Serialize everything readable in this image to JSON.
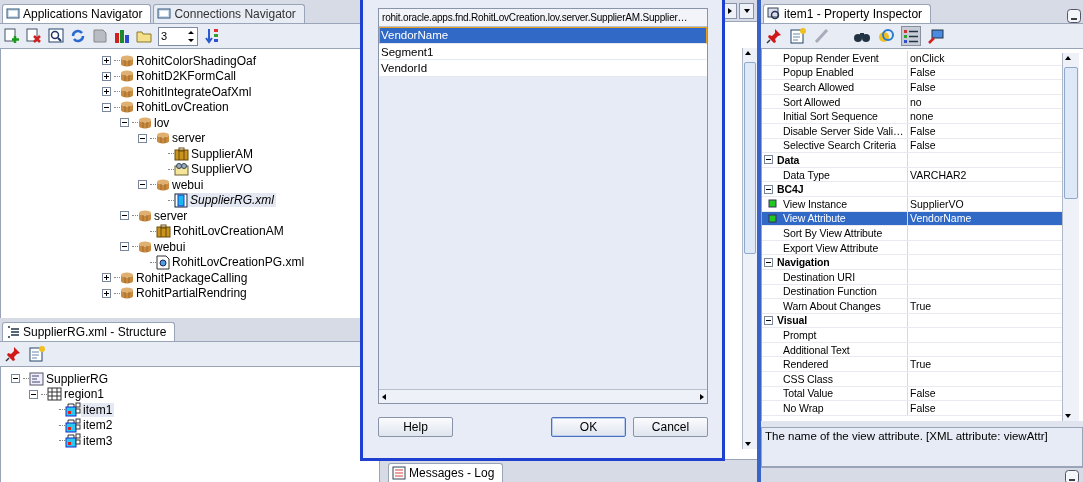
{
  "navigator": {
    "tabs": [
      {
        "label": "Applications Navigator",
        "selected": true
      },
      {
        "label": "Connections Navigator",
        "selected": false
      }
    ],
    "levels": "3",
    "tree": [
      {
        "label": "RohitColorShadingOaf",
        "kind": "package",
        "expanded": false
      },
      {
        "label": "RohitD2KFormCall",
        "kind": "package",
        "expanded": false
      },
      {
        "label": "RohitIntegrateOafXml",
        "kind": "package",
        "expanded": false
      },
      {
        "label": "RohitLovCreation",
        "kind": "package",
        "expanded": true,
        "children": [
          {
            "label": "lov",
            "kind": "package",
            "expanded": true,
            "children": [
              {
                "label": "server",
                "kind": "package",
                "expanded": true,
                "children": [
                  {
                    "label": "SupplierAM",
                    "kind": "module"
                  },
                  {
                    "label": "SupplierVO",
                    "kind": "view"
                  }
                ]
              },
              {
                "label": "webui",
                "kind": "package",
                "expanded": true,
                "children": [
                  {
                    "label": "SupplierRG.xml",
                    "kind": "region",
                    "selected": true
                  }
                ]
              }
            ]
          },
          {
            "label": "server",
            "kind": "package",
            "expanded": true,
            "children": [
              {
                "label": "RohitLovCreationAM",
                "kind": "module"
              }
            ]
          },
          {
            "label": "webui",
            "kind": "package",
            "expanded": true,
            "children": [
              {
                "label": "RohitLovCreationPG.xml",
                "kind": "page"
              }
            ]
          }
        ]
      },
      {
        "label": "RohitPackageCalling",
        "kind": "package",
        "expanded": false
      },
      {
        "label": "RohitPartialRendring",
        "kind": "package",
        "expanded": false
      }
    ]
  },
  "structure": {
    "tab": "SupplierRG.xml - Structure",
    "tree": [
      {
        "label": "SupplierRG",
        "kind": "root",
        "expanded": true,
        "children": [
          {
            "label": "region1",
            "kind": "table",
            "expanded": true,
            "children": [
              {
                "label": "item1",
                "kind": "item",
                "selected": true
              },
              {
                "label": "item2",
                "kind": "item",
                "selected": false
              },
              {
                "label": "item3",
                "kind": "item",
                "selected": false
              }
            ]
          }
        ]
      }
    ]
  },
  "editor": {
    "bottom_tab": "Messages - Log"
  },
  "dialog": {
    "header": "rohit.oracle.apps.fnd.RohitLovCreation.lov.server.SupplierAM.Supplier…",
    "rows": [
      {
        "label": "VendorName",
        "selected": true
      },
      {
        "label": "Segment1",
        "selected": false
      },
      {
        "label": "VendorId",
        "selected": false
      }
    ],
    "buttons": [
      {
        "label": "Help",
        "default": false
      },
      {
        "label": "OK",
        "default": true
      },
      {
        "label": "Cancel",
        "default": false
      }
    ]
  },
  "inspector": {
    "tab": "item1 - Property Inspector",
    "rows": [
      {
        "kind": "property",
        "name": "Popup Render Event",
        "value": "onClick",
        "selected": false
      },
      {
        "kind": "property",
        "name": "Popup Enabled",
        "value": "False",
        "selected": false
      },
      {
        "kind": "property",
        "name": "Search Allowed",
        "value": "False",
        "selected": false
      },
      {
        "kind": "property",
        "name": "Sort Allowed",
        "value": "no",
        "selected": false
      },
      {
        "kind": "property",
        "name": "Initial Sort Sequence",
        "value": "none",
        "selected": false
      },
      {
        "kind": "property",
        "name": "Disable Server Side Vali…",
        "value": "False",
        "selected": false
      },
      {
        "kind": "property",
        "name": "Selective Search Criteria",
        "value": "False",
        "selected": false
      },
      {
        "kind": "section",
        "name": "Data",
        "expanded": true
      },
      {
        "kind": "property",
        "name": "Data Type",
        "value": "VARCHAR2",
        "selected": false
      },
      {
        "kind": "section",
        "name": "BC4J",
        "expanded": true
      },
      {
        "kind": "bound",
        "name": "View Instance",
        "value": "SupplierVO",
        "selected": false
      },
      {
        "kind": "bound",
        "name": "View Attribute",
        "value": "VendorName",
        "selected": true
      },
      {
        "kind": "property",
        "name": "Sort By View Attribute",
        "selected": false
      },
      {
        "kind": "property",
        "name": "Export View Attribute",
        "selected": false
      },
      {
        "kind": "section",
        "name": "Navigation",
        "expanded": true
      },
      {
        "kind": "property",
        "name": "Destination URI",
        "selected": false
      },
      {
        "kind": "property",
        "name": "Destination Function",
        "selected": false
      },
      {
        "kind": "property",
        "name": "Warn About Changes",
        "value": "True",
        "selected": false
      },
      {
        "kind": "section",
        "name": "Visual",
        "expanded": true
      },
      {
        "kind": "property",
        "name": "Prompt",
        "selected": false
      },
      {
        "kind": "property",
        "name": "Additional Text",
        "selected": false
      },
      {
        "kind": "property",
        "name": "Rendered",
        "value": "True",
        "selected": false
      },
      {
        "kind": "property",
        "name": "CSS Class",
        "selected": false
      },
      {
        "kind": "property",
        "name": "Total Value",
        "value": "False",
        "selected": false
      },
      {
        "kind": "property",
        "name": "No Wrap",
        "value": "False",
        "selected": false
      }
    ],
    "description": "The name of the view attribute. [XML attribute: viewAttr]"
  }
}
